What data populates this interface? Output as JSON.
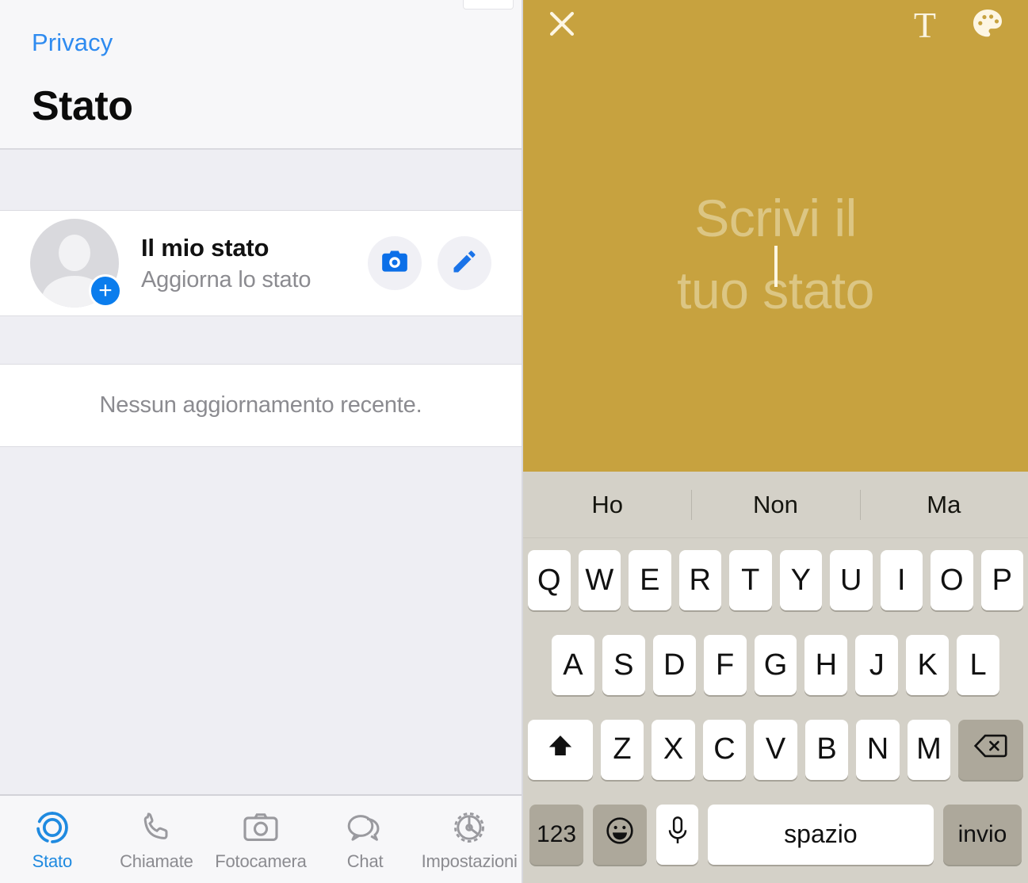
{
  "left": {
    "nav": {
      "back_label": "Privacy",
      "title": "Stato"
    },
    "status": {
      "title": "Il mio stato",
      "subtitle": "Aggiorna lo stato",
      "add_badge": "+",
      "camera_icon": "camera-icon",
      "edit_icon": "pencil-icon"
    },
    "empty_state": "Nessun aggiornamento recente.",
    "tabs": [
      {
        "label": "Stato",
        "icon": "status-rings-icon",
        "active": true
      },
      {
        "label": "Chiamate",
        "icon": "phone-icon",
        "active": false
      },
      {
        "label": "Fotocamera",
        "icon": "camera-icon",
        "active": false
      },
      {
        "label": "Chat",
        "icon": "chat-bubbles-icon",
        "active": false
      },
      {
        "label": "Impostazioni",
        "icon": "gear-icon",
        "active": false
      }
    ],
    "colors": {
      "accent": "#1f8ae0",
      "background": "#eeeef3",
      "card": "#ffffff"
    }
  },
  "right": {
    "compose": {
      "background_color": "#c7a23f",
      "close_icon": "close-icon",
      "font_icon": "text-font-icon",
      "font_icon_label": "T",
      "palette_icon": "color-palette-icon",
      "placeholder_line1": "Scrivi il",
      "placeholder_line2": "tuo stato",
      "placeholder_color": "#dcc684",
      "caret_visible": true
    },
    "keyboard": {
      "background_color": "#d4d1c8",
      "suggestions": [
        "Ho",
        "Non",
        "Ma"
      ],
      "row1": [
        "Q",
        "W",
        "E",
        "R",
        "T",
        "Y",
        "U",
        "I",
        "O",
        "P"
      ],
      "row2": [
        "A",
        "S",
        "D",
        "F",
        "G",
        "H",
        "J",
        "K",
        "L"
      ],
      "row3_shift": "shift-icon",
      "row3": [
        "Z",
        "X",
        "C",
        "V",
        "B",
        "N",
        "M"
      ],
      "row3_backspace": "backspace-icon",
      "numbers_key": "123",
      "emoji_key": "emoji-icon",
      "mic_key": "microphone-icon",
      "space_key": "spazio",
      "return_key": "invio"
    }
  }
}
